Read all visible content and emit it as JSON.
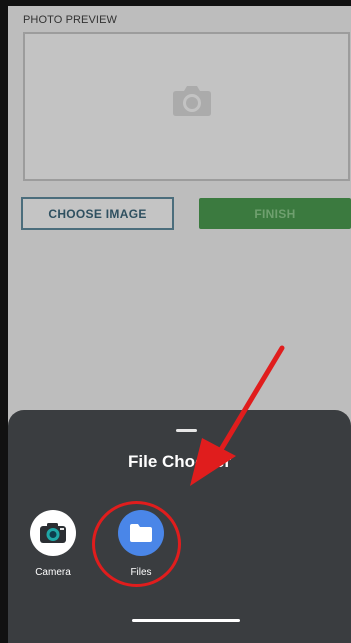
{
  "app": {
    "photo_preview_label": "PHOTO PREVIEW",
    "choose_image_label": "CHOOSE IMAGE",
    "finish_label": "FINISH"
  },
  "sheet": {
    "title": "File Chooser",
    "options": [
      {
        "label": "Camera",
        "icon": "camera-icon"
      },
      {
        "label": "Files",
        "icon": "folder-icon"
      }
    ]
  },
  "annotation": {
    "color": "#e01d1d",
    "arrow_icon": "pointer-arrow-icon",
    "highlight": "files"
  },
  "colors": {
    "sheet_background": "#3a3d40",
    "files_icon_background": "#4a86e8",
    "finish_button": "#3b7a3f"
  }
}
